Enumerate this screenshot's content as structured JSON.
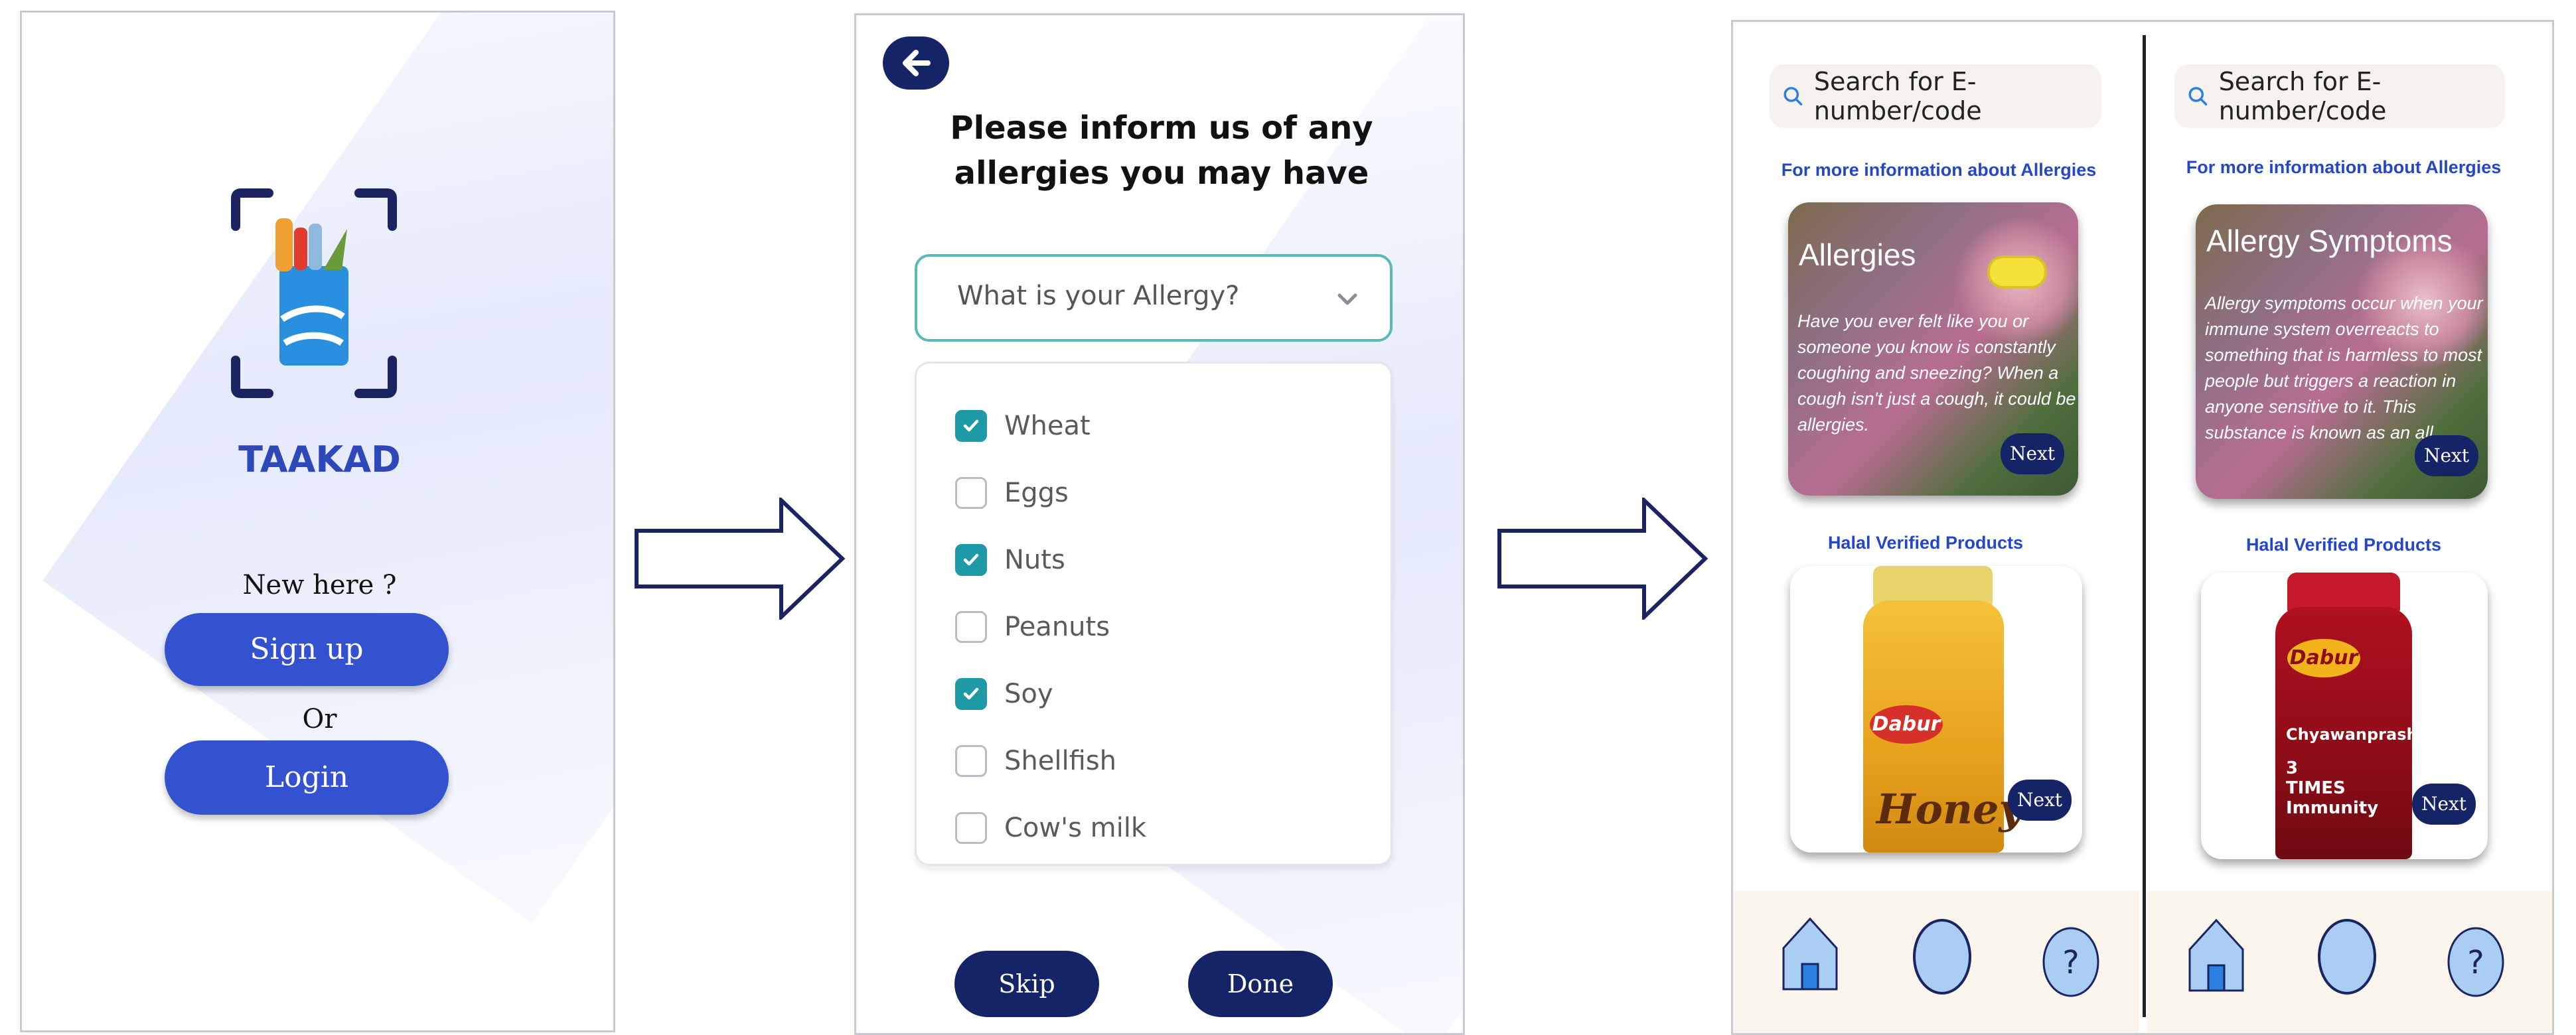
{
  "screen1": {
    "app_name": "TAAKAD",
    "new_here": "New here ?",
    "signup_label": "Sign up",
    "or_label": "Or",
    "login_label": "Login"
  },
  "screen2": {
    "title_line1": "Please inform us of any",
    "title_line2": "allergies you may have",
    "select_placeholder": "What is  your Allergy?",
    "options": [
      {
        "label": "Wheat",
        "checked": true
      },
      {
        "label": "Eggs",
        "checked": false
      },
      {
        "label": "Nuts",
        "checked": true
      },
      {
        "label": "Peanuts",
        "checked": false
      },
      {
        "label": "Soy",
        "checked": true
      },
      {
        "label": "Shellfish",
        "checked": false
      },
      {
        "label": "Cow's milk",
        "checked": false
      }
    ],
    "skip_label": "Skip",
    "done_label": "Done"
  },
  "screen3": {
    "left": {
      "search_placeholder": "Search for E-number/code",
      "allergy_link": "For more information about Allergies",
      "card_title": "Allergies",
      "card_text": "Have you ever felt like you or someone you know is constantly coughing and sneezing? When a cough isn't just a cough, it could be allergies.",
      "card_next": "Next",
      "halal_link": "Halal Verified Products",
      "product_brand": "Dabur",
      "product_name": "Honey",
      "product_next": "Next"
    },
    "right": {
      "search_placeholder": "Search for E-number/code",
      "allergy_link": "For more information about Allergies",
      "card_title": "Allergy Symptoms",
      "card_text": "Allergy symptoms occur when your immune system overreacts to something that is harmless to most people but triggers a reaction in anyone sensitive to it. This substance is known as an all",
      "card_next": "Next",
      "halal_link": "Halal Verified Products",
      "product_brand": "Dabur",
      "product_name": "Chyawanprash",
      "product_badge": "3 TIMES Immunity",
      "product_next": "Next"
    },
    "nav_help_glyph": "?"
  }
}
